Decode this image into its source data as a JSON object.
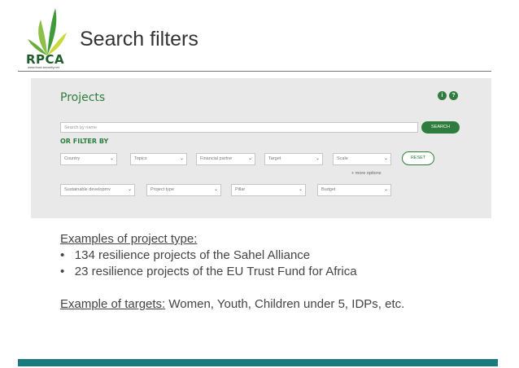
{
  "logo": {
    "text": "RPCA",
    "subtext": "www.food-security.net"
  },
  "slide": {
    "title": "Search filters"
  },
  "screenshot": {
    "projects_title": "Projects",
    "circle_icons": [
      "i",
      "?"
    ],
    "search_placeholder": "Search by name",
    "search_button": "SEARCH",
    "filter_heading": "OR FILTER BY",
    "filters_row1": [
      "Country",
      "Topics",
      "Financial partne",
      "Target",
      "Scale"
    ],
    "reset_button": "RESET",
    "more_options": "+ more options",
    "filters_row2": [
      "Sustainable developmv",
      "Project type",
      "Pillar",
      "Budget"
    ]
  },
  "examples": {
    "heading": "Examples of project type:",
    "bullet_char": "•",
    "bullets": [
      "134 resilience projects of the Sahel Alliance",
      "23 resilience projects of the EU Trust Fund for Africa"
    ],
    "targets_label": "Example of targets:",
    "targets_text": " Women, Youth, Children under 5, IDPs, etc."
  },
  "colors": {
    "green": "#2e7d3e",
    "teal_bar": "#1a7a80",
    "screen_bg": "#e9e9e9"
  }
}
